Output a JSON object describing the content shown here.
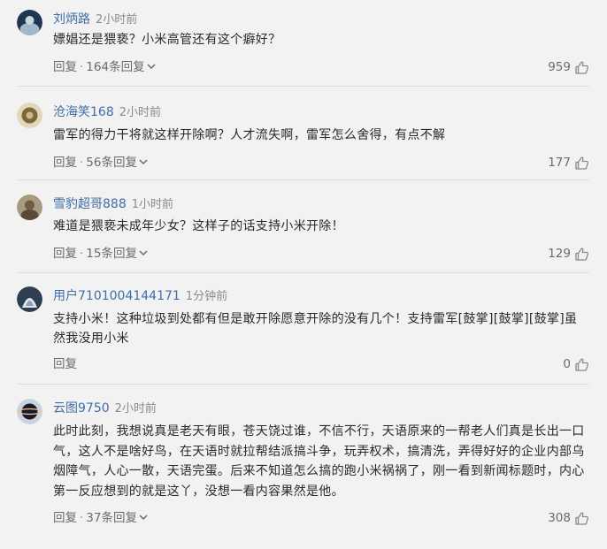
{
  "comments": [
    {
      "username": "刘炳路",
      "time": "2小时前",
      "text": "嫖娼还是猥亵？小米高管还有这个癖好？",
      "reply_label": "回复",
      "separator": "·",
      "replies_label": "164条回复",
      "like_count": "959",
      "avatar_colors": [
        "#1f3550",
        "#9fb9c9"
      ]
    },
    {
      "username": "沧海笑168",
      "time": "2小时前",
      "text": "雷军的得力干将就这样开除啊？人才流失啊，雷军怎么舍得，有点不解",
      "reply_label": "回复",
      "separator": "·",
      "replies_label": "56条回复",
      "like_count": "177",
      "avatar_colors": [
        "#7a6a3a",
        "#e0d8b8"
      ]
    },
    {
      "username": "雪豹超哥888",
      "time": "1小时前",
      "text": "难道是猥亵未成年少女？这样子的话支持小米开除！",
      "reply_label": "回复",
      "separator": "·",
      "replies_label": "15条回复",
      "like_count": "129",
      "avatar_colors": [
        "#5a4a38",
        "#a89a80"
      ]
    },
    {
      "username": "用户7101004144171",
      "time": "1分钟前",
      "text": "支持小米！这种垃圾到处都有但是敢开除愿意开除的没有几个！支持雷军[鼓掌][鼓掌][鼓掌]虽然我没用小米",
      "reply_label": "回复",
      "like_count": "0",
      "avatar_colors": [
        "#2f3f52",
        "#dfe6ee"
      ]
    },
    {
      "username": "云图9750",
      "time": "2小时前",
      "text": "此时此刻，我想说真是老天有眼，苍天饶过谁，不信不行，天语原来的一帮老人们真是长出一口气，这人不是啥好鸟，在天语时就拉帮结派搞斗争，玩弄权术，搞清洗，弄得好好的企业内部乌烟障气，人心一散，天语完蛋。后来不知道怎么搞的跑小米祸祸了，刚一看到新闻标题时，内心第一反应想到的就是这丫，没想一看内容果然是他。",
      "reply_label": "回复",
      "separator": "·",
      "replies_label": "37条回复",
      "like_count": "308",
      "avatar_colors": [
        "#1a1a2a",
        "#c9d2e0"
      ]
    }
  ],
  "icons": {
    "like": "thumbs-up-icon",
    "expand": "chevron-down-icon"
  }
}
